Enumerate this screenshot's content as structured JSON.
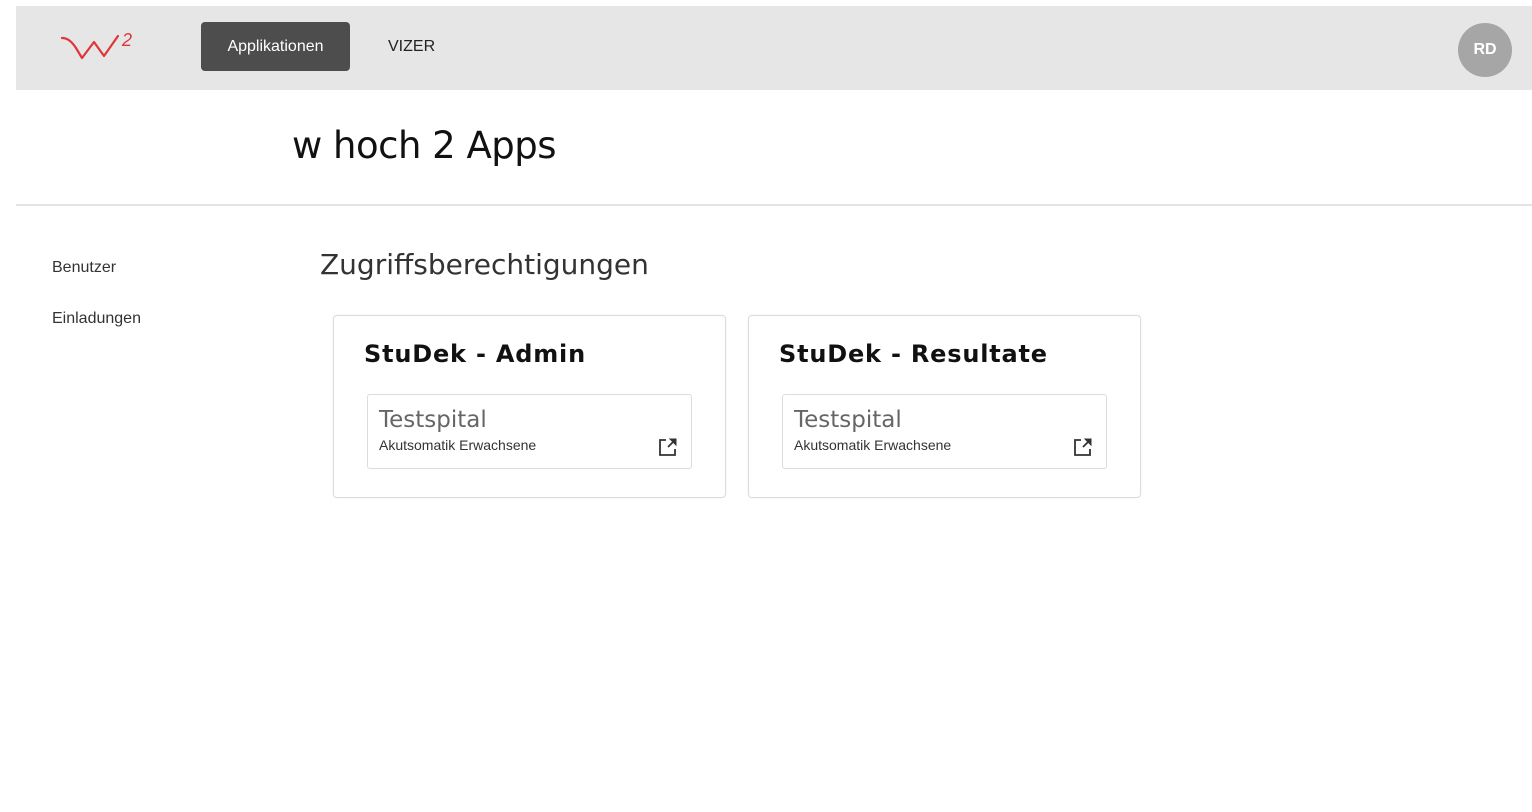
{
  "brand": {
    "logo_text": "W2",
    "logo_color": "#e0363a"
  },
  "topbar": {
    "nav": [
      {
        "label": "Applikationen",
        "active": true
      },
      {
        "label": "VIZER",
        "active": false
      }
    ],
    "avatar_initials": "RD"
  },
  "header": {
    "title": "w hoch 2 Apps"
  },
  "sidebar": {
    "items": [
      {
        "label": "Benutzer"
      },
      {
        "label": "Einladungen"
      }
    ]
  },
  "main": {
    "section_title": "Zugriffsberechtigungen",
    "cards": [
      {
        "title": "StuDek - Admin",
        "entries": [
          {
            "name": "Testspital",
            "subtitle": "Akutsomatik Erwachsene",
            "icon": "external-link-icon"
          }
        ]
      },
      {
        "title": "StuDek - Resultate",
        "entries": [
          {
            "name": "Testspital",
            "subtitle": "Akutsomatik Erwachsene",
            "icon": "external-link-icon"
          }
        ]
      }
    ]
  },
  "colors": {
    "topbar_bg": "#e6e6e6",
    "active_nav_bg": "#4d4d4d",
    "avatar_bg": "#a6a6a6"
  }
}
